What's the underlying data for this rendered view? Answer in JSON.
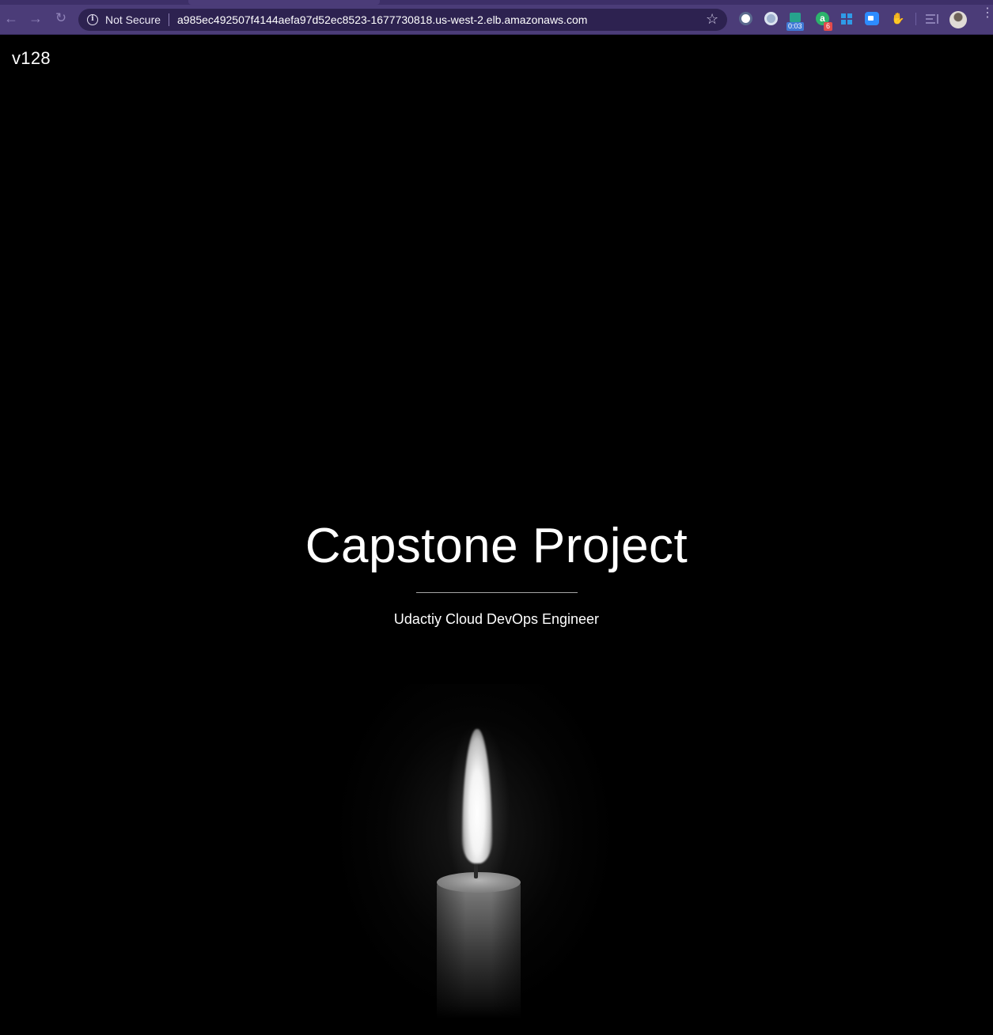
{
  "browser": {
    "security_label": "Not Secure",
    "url": "a985ec492507f4144aefa97d52ec8523-1677730818.us-west-2.elb.amazonaws.com",
    "extensions": [
      {
        "icon": "onepassword-icon"
      },
      {
        "icon": "circle-extension-icon"
      },
      {
        "icon": "timer-extension-icon",
        "badge": "0:03"
      },
      {
        "icon": "grammarly-icon",
        "badge": "6"
      },
      {
        "icon": "windows-icon"
      },
      {
        "icon": "zoom-icon"
      },
      {
        "icon": "hand-icon"
      },
      {
        "icon": "reading-list-icon"
      }
    ]
  },
  "page": {
    "version": "v128",
    "title": "Capstone Project",
    "subtitle": "Udactiy Cloud DevOps Engineer"
  },
  "colors": {
    "chrome": "#4b3c78",
    "omnibox": "#2d2250",
    "background": "#000000",
    "text": "#ffffff"
  }
}
